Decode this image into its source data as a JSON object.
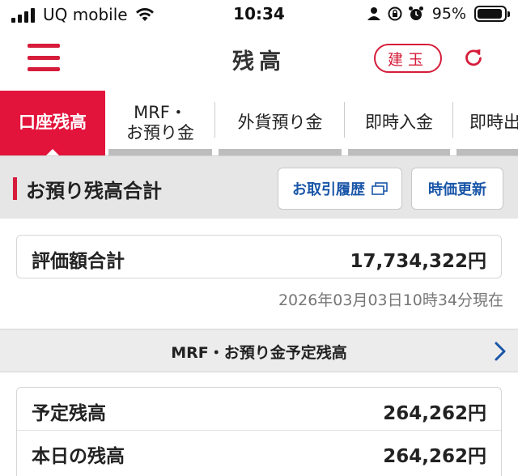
{
  "statusbar": {
    "carrier": "UQ mobile",
    "time": "10:34",
    "battery_pct": "95%",
    "battery_level": 0.95,
    "icons": [
      "signal-icon",
      "wifi-icon",
      "person-icon",
      "rotation-lock-icon",
      "alarm-icon",
      "battery-icon"
    ]
  },
  "header": {
    "title": "残高",
    "position_button": "建玉",
    "icons": [
      "menu-icon",
      "refresh-icon"
    ],
    "accent_color": "#d61c3a"
  },
  "tabs": [
    {
      "label": "口座残高",
      "active": true
    },
    {
      "label": "MRF・\nお預り金",
      "active": false
    },
    {
      "label": "外貨預り金",
      "active": false
    },
    {
      "label": "即時入金",
      "active": false
    },
    {
      "label": "即時出",
      "active": false
    }
  ],
  "section": {
    "title": "お預り残高合計",
    "history_button": "お取引履歴",
    "update_button": "時価更新",
    "link_color": "#1a56a8"
  },
  "total": {
    "label": "評価額合計",
    "value": "17,734,322円",
    "as_of": "2026年03月03日10時34分現在"
  },
  "mrf": {
    "title": "MRF・お預り金予定残高",
    "rows": [
      {
        "label": "予定残高",
        "value": "264,262円"
      },
      {
        "label": "本日の残高",
        "value": "264,262円"
      }
    ]
  }
}
